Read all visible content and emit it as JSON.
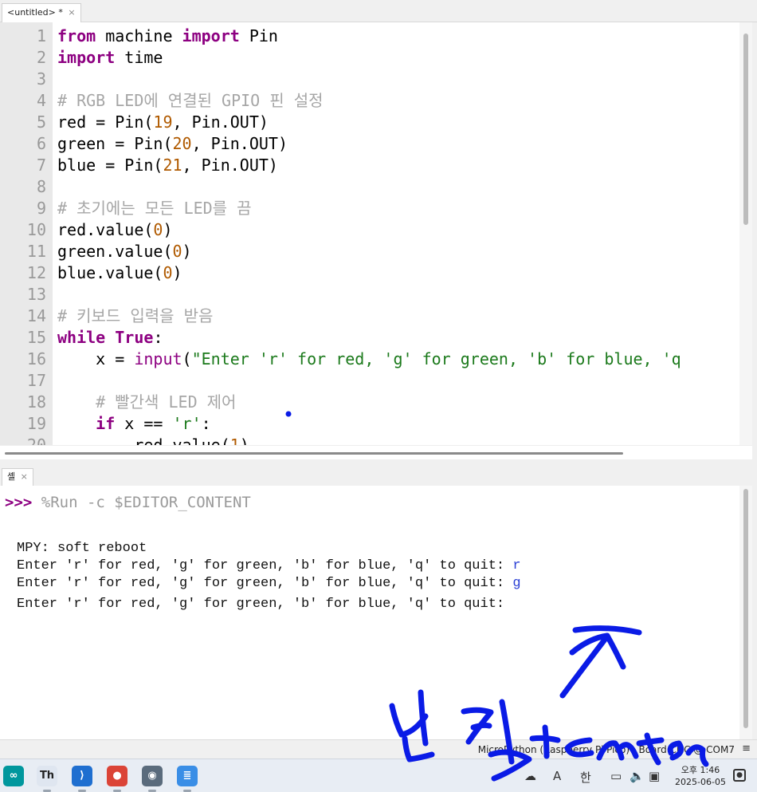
{
  "editor_tab": {
    "title": "<untitled>",
    "modified": "*",
    "close": "×"
  },
  "editor": {
    "line_numbers": [
      "1",
      "2",
      "3",
      "4",
      "5",
      "6",
      "7",
      "8",
      "9",
      "10",
      "11",
      "12",
      "13",
      "14",
      "15",
      "16",
      "17",
      "18",
      "19",
      "20"
    ],
    "lines": [
      [
        {
          "t": "from",
          "c": "kw"
        },
        {
          "t": " machine ",
          "c": ""
        },
        {
          "t": "import",
          "c": "kw"
        },
        {
          "t": " Pin",
          "c": ""
        }
      ],
      [
        {
          "t": "import",
          "c": "kw"
        },
        {
          "t": " time",
          "c": ""
        }
      ],
      [],
      [
        {
          "t": "# RGB LED에 연결된 GPIO 핀 설정",
          "c": "cm"
        }
      ],
      [
        {
          "t": "red = Pin(",
          "c": ""
        },
        {
          "t": "19",
          "c": "num"
        },
        {
          "t": ", Pin.OUT)",
          "c": ""
        }
      ],
      [
        {
          "t": "green = Pin(",
          "c": ""
        },
        {
          "t": "20",
          "c": "num"
        },
        {
          "t": ", Pin.OUT)",
          "c": ""
        }
      ],
      [
        {
          "t": "blue = Pin(",
          "c": ""
        },
        {
          "t": "21",
          "c": "num"
        },
        {
          "t": ", Pin.OUT)",
          "c": ""
        }
      ],
      [],
      [
        {
          "t": "# 초기에는 모든 LED를 끔",
          "c": "cm"
        }
      ],
      [
        {
          "t": "red.value(",
          "c": ""
        },
        {
          "t": "0",
          "c": "num"
        },
        {
          "t": ")",
          "c": ""
        }
      ],
      [
        {
          "t": "green.value(",
          "c": ""
        },
        {
          "t": "0",
          "c": "num"
        },
        {
          "t": ")",
          "c": ""
        }
      ],
      [
        {
          "t": "blue.value(",
          "c": ""
        },
        {
          "t": "0",
          "c": "num"
        },
        {
          "t": ")",
          "c": ""
        }
      ],
      [],
      [
        {
          "t": "# 키보드 입력을 받음",
          "c": "cm"
        }
      ],
      [
        {
          "t": "while",
          "c": "kw"
        },
        {
          "t": " ",
          "c": ""
        },
        {
          "t": "True",
          "c": "kw"
        },
        {
          "t": ":",
          "c": ""
        }
      ],
      [
        {
          "t": "    x = ",
          "c": ""
        },
        {
          "t": "input",
          "c": "bi"
        },
        {
          "t": "(",
          "c": ""
        },
        {
          "t": "\"Enter 'r' for red, 'g' for green, 'b' for blue, 'q",
          "c": "str"
        }
      ],
      [],
      [
        {
          "t": "    # 빨간색 LED 제어",
          "c": "cm"
        }
      ],
      [
        {
          "t": "    ",
          "c": ""
        },
        {
          "t": "if",
          "c": "kw"
        },
        {
          "t": " x == ",
          "c": ""
        },
        {
          "t": "'r'",
          "c": "str"
        },
        {
          "t": ":",
          "c": ""
        }
      ],
      [
        {
          "t": "        red.value(",
          "c": ""
        },
        {
          "t": "1",
          "c": "num"
        },
        {
          "t": ")",
          "c": ""
        }
      ]
    ]
  },
  "shell_tab": {
    "title": "셸",
    "close": "×"
  },
  "shell": {
    "prompt": ">>>",
    "command": " %Run -c $EDITOR_CONTENT",
    "output": [
      {
        "text": "MPY: soft reboot",
        "input": ""
      },
      {
        "text": "Enter 'r' for red, 'g' for green, 'b' for blue, 'q' to quit: ",
        "input": "r"
      },
      {
        "text": "Enter 'r' for red, 'g' for green, 'b' for blue, 'q' to quit: ",
        "input": "g"
      },
      {
        "text": "Enter 'r' for red, 'g' for green, 'b' for blue, 'q' to quit:",
        "input": ""
      }
    ]
  },
  "statusbar": {
    "interpreter": "MicroPython (Raspberry Pi Pico) · Board CDC @ COM7",
    "menu": "≡"
  },
  "taskbar": {
    "apps": [
      {
        "name": "arduino-icon",
        "color": "#00979d",
        "glyph": "∞"
      },
      {
        "name": "thonny-icon",
        "color": "#dfe6f0",
        "glyph": "Th"
      },
      {
        "name": "vscode-icon",
        "color": "#1f6fd0",
        "glyph": "⟩"
      },
      {
        "name": "chrome-icon",
        "color": "#db4437",
        "glyph": "●"
      },
      {
        "name": "camera-icon",
        "color": "#5a6b7c",
        "glyph": "◉"
      },
      {
        "name": "notepad-icon",
        "color": "#3a8ee6",
        "glyph": "≣"
      }
    ],
    "tray": [
      {
        "name": "cloud-icon",
        "glyph": "☁"
      },
      {
        "name": "ime-a-icon",
        "glyph": "A"
      },
      {
        "name": "ime-korean-icon",
        "glyph": "한"
      },
      {
        "name": "network-icon",
        "glyph": "▭"
      },
      {
        "name": "volume-icon",
        "glyph": "🔈"
      },
      {
        "name": "battery-icon",
        "glyph": "▣"
      }
    ],
    "clock_time": "오후 1:46",
    "clock_date": "2025-06-05",
    "notification": "●"
  },
  "annotation": {
    "color": "#0a1be6",
    "text": "입력+enter"
  }
}
